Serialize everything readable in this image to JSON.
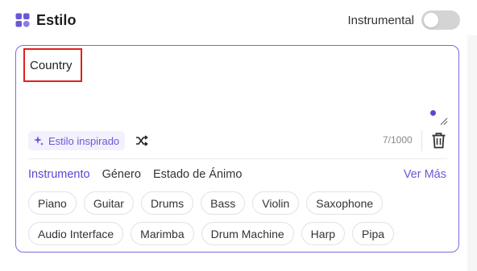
{
  "header": {
    "title": "Estilo",
    "icon": "grid-shapes-icon",
    "toggle": {
      "label": "Instrumental",
      "on": false
    }
  },
  "style_box": {
    "value": "Country",
    "inspire_label": "Estilo inspirado",
    "counter": "7/1000"
  },
  "tabs": [
    {
      "label": "Instrumento",
      "active": true
    },
    {
      "label": "Género",
      "active": false
    },
    {
      "label": "Estado de Ánimo",
      "active": false
    }
  ],
  "more_label": "Ver Más",
  "chips": [
    "Piano",
    "Guitar",
    "Drums",
    "Bass",
    "Violin",
    "Saxophone",
    "Audio Interface",
    "Marimba",
    "Drum Machine",
    "Harp",
    "Pipa"
  ],
  "colors": {
    "accent": "#5b45d6",
    "highlight_border": "#e02020",
    "card_border": "#7a6be0",
    "toggle_off": "#d4d4d4"
  }
}
